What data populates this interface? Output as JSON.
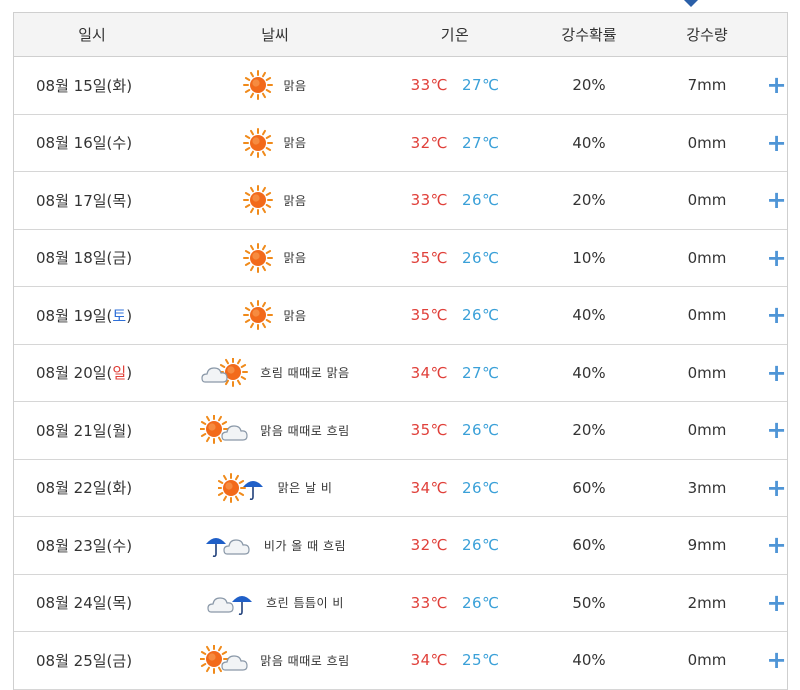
{
  "header": {
    "date": "일시",
    "weather": "날씨",
    "temp": "기온",
    "prob": "강수확률",
    "amount": "강수량"
  },
  "rows": [
    {
      "date_pre": "08월 15일(",
      "day": "화",
      "date_post": ")",
      "day_type": "weekday",
      "weather": "맑음",
      "icon": "sun-icon",
      "hi": "33℃",
      "lo": "27℃",
      "prob": "20%",
      "amount": "7mm",
      "plus": "+"
    },
    {
      "date_pre": "08월 16일(",
      "day": "수",
      "date_post": ")",
      "day_type": "weekday",
      "weather": "맑음",
      "icon": "sun-icon",
      "hi": "32℃",
      "lo": "27℃",
      "prob": "40%",
      "amount": "0mm",
      "plus": "+"
    },
    {
      "date_pre": "08월 17일(",
      "day": "목",
      "date_post": ")",
      "day_type": "weekday",
      "weather": "맑음",
      "icon": "sun-icon",
      "hi": "33℃",
      "lo": "26℃",
      "prob": "20%",
      "amount": "0mm",
      "plus": "+"
    },
    {
      "date_pre": "08월 18일(",
      "day": "금",
      "date_post": ")",
      "day_type": "weekday",
      "weather": "맑음",
      "icon": "sun-icon",
      "hi": "35℃",
      "lo": "26℃",
      "prob": "10%",
      "amount": "0mm",
      "plus": "+"
    },
    {
      "date_pre": "08월 19일(",
      "day": "토",
      "date_post": ")",
      "day_type": "saturday",
      "weather": "맑음",
      "icon": "sun-icon",
      "hi": "35℃",
      "lo": "26℃",
      "prob": "40%",
      "amount": "0mm",
      "plus": "+"
    },
    {
      "date_pre": "08월 20일(",
      "day": "일",
      "date_post": ")",
      "day_type": "sunday",
      "weather": "흐림 때때로 맑음",
      "icon": "cloud-sun-icon",
      "hi": "34℃",
      "lo": "27℃",
      "prob": "40%",
      "amount": "0mm",
      "plus": "+"
    },
    {
      "date_pre": "08월 21일(",
      "day": "월",
      "date_post": ")",
      "day_type": "weekday",
      "weather": "맑음 때때로 흐림",
      "icon": "sun-cloud-icon",
      "hi": "35℃",
      "lo": "26℃",
      "prob": "20%",
      "amount": "0mm",
      "plus": "+"
    },
    {
      "date_pre": "08월 22일(",
      "day": "화",
      "date_post": ")",
      "day_type": "weekday",
      "weather": "맑은 날 비",
      "icon": "sun-umbrella-icon",
      "hi": "34℃",
      "lo": "26℃",
      "prob": "60%",
      "amount": "3mm",
      "plus": "+"
    },
    {
      "date_pre": "08월 23일(",
      "day": "수",
      "date_post": ")",
      "day_type": "weekday",
      "weather": "비가 올 때 흐림",
      "icon": "umbrella-cloud-icon",
      "hi": "32℃",
      "lo": "26℃",
      "prob": "60%",
      "amount": "9mm",
      "plus": "+"
    },
    {
      "date_pre": "08월 24일(",
      "day": "목",
      "date_post": ")",
      "day_type": "weekday",
      "weather": "흐린 틈틈이 비",
      "icon": "cloud-umbrella-icon",
      "hi": "33℃",
      "lo": "26℃",
      "prob": "50%",
      "amount": "2mm",
      "plus": "+"
    },
    {
      "date_pre": "08월 25일(",
      "day": "금",
      "date_post": ")",
      "day_type": "weekday",
      "weather": "맑음 때때로 흐림",
      "icon": "sun-cloud-icon",
      "hi": "34℃",
      "lo": "25℃",
      "prob": "40%",
      "amount": "0mm",
      "plus": "+"
    }
  ],
  "colors": {
    "high_temp": "#e0403a",
    "low_temp": "#3aa0d8",
    "saturday": "#2e6fd8",
    "sunday": "#e0403a",
    "plus": "#4f95d6"
  }
}
